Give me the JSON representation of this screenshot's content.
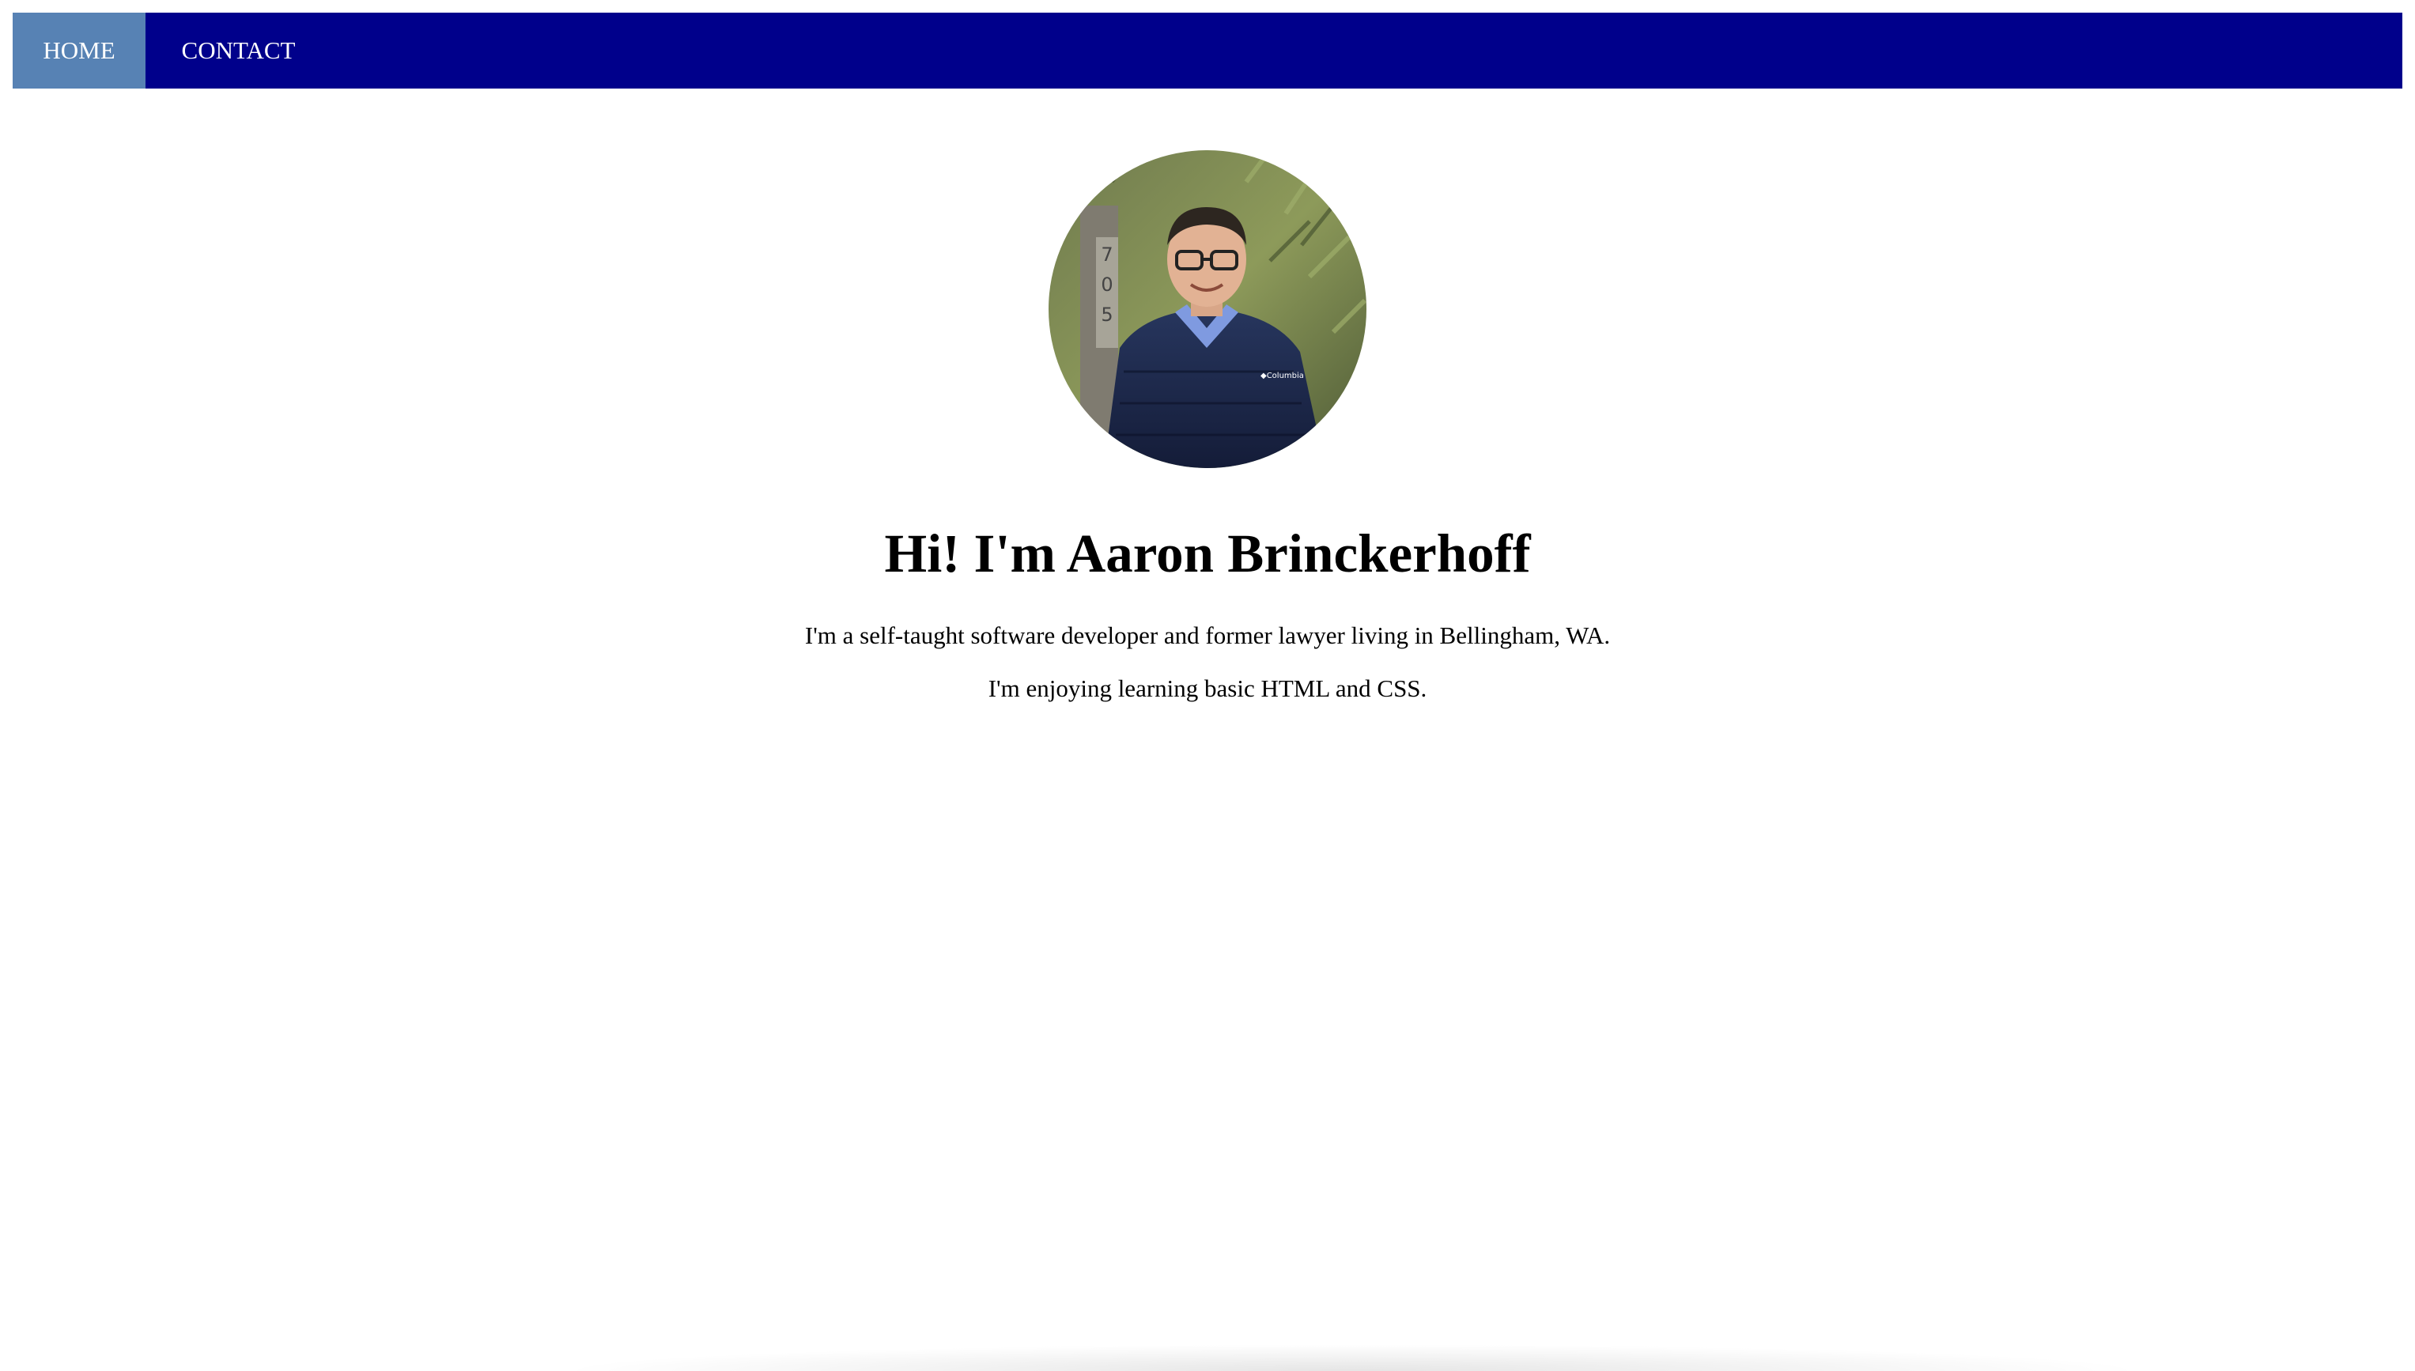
{
  "nav": {
    "items": [
      {
        "label": "HOME",
        "active": true
      },
      {
        "label": "CONTACT",
        "active": false
      }
    ],
    "background_color": "#00008b",
    "active_color": "#5782b4"
  },
  "profile": {
    "avatar_icon": "profile-photo"
  },
  "main": {
    "headline": "Hi! I'm Aaron Brinckerhoff",
    "intro_line_1": "I'm a self-taught software developer and former lawyer living in Bellingham, WA.",
    "intro_line_2": "I'm enjoying learning basic HTML and CSS."
  }
}
